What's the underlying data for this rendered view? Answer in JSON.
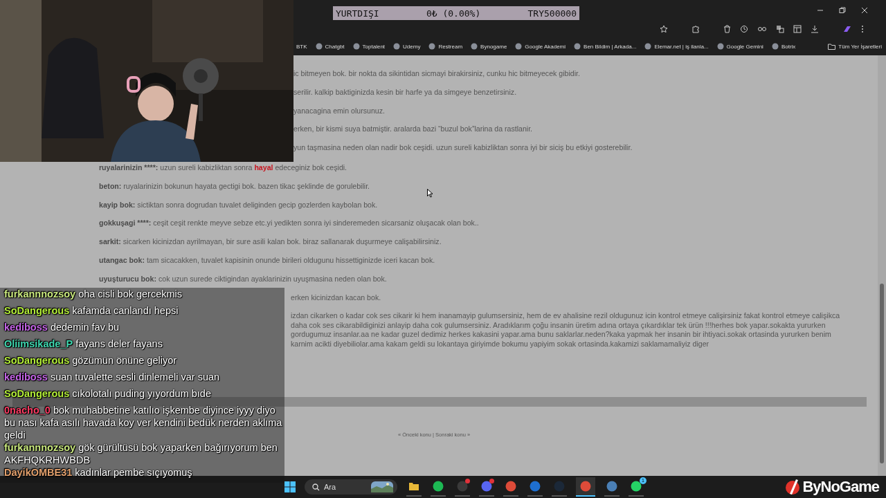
{
  "ticker": {
    "label": "YURTDIŞI",
    "change": "0₺ (0.00%)",
    "amount": "TRY500000"
  },
  "bookmarks": [
    {
      "label": "BTK",
      "kind": "plain"
    },
    {
      "label": "Chatgbt",
      "kind": "site"
    },
    {
      "label": "Toptalent",
      "kind": "site"
    },
    {
      "label": "Udemy",
      "kind": "site"
    },
    {
      "label": "Restream",
      "kind": "site"
    },
    {
      "label": "Bynogame",
      "kind": "site"
    },
    {
      "label": "Google Akademi",
      "kind": "site"
    },
    {
      "label": "Ben Bildim | Arkada...",
      "kind": "site"
    },
    {
      "label": "Elemar.net | iş ilanla...",
      "kind": "site"
    },
    {
      "label": "Google Gemini",
      "kind": "site"
    },
    {
      "label": "Botrix",
      "kind": "site"
    }
  ],
  "all_bookmarks": "Tüm Yer İşaretleri",
  "top_lines": [
    "ic bitmeyen bok. bir nokta da sikintidan sicmayi birakirsiniz, cunku hic bitmeyecek gibidir.",
    "serilir. kalkip baktiginizda kesin bir harfe ya da simgeye benzetirsiniz.",
    "yanacagina emin olursunuz.",
    "erken, bir kismi suya batmiştir. aralarda bazi “buzul bok”larina da rastlanir.",
    "yun taşmasina neden olan nadir bok ceşidi. uzun sureli kabizliktan sonra iyi bir siciş bu etkiyi gosterebilir."
  ],
  "entries": [
    {
      "term": "ruyalarinizin ****:",
      "segments": [
        {
          "text": "uzun sureli kabizliktan sonra",
          "kind": "plain"
        },
        {
          "text": "hayal",
          "kind": "red"
        },
        {
          "text": "edeceginiz bok ceşidi.",
          "kind": "plain"
        }
      ]
    },
    {
      "term": "beton:",
      "segments": [
        {
          "text": "ruyalarinizin bokunun hayata gectigi bok. bazen tikac şeklinde de gorulebilir.",
          "kind": "plain"
        }
      ]
    },
    {
      "term": "kayip bok:",
      "segments": [
        {
          "text": "sictiktan sonra dogrudan tuvalet deliginden gecip gozlerden kaybolan bok.",
          "kind": "plain"
        }
      ]
    },
    {
      "term": "gokkuşagi ****:",
      "segments": [
        {
          "text": "ceşit ceşit renkte meyve sebze etc.yi yedikten sonra iyi sinderemeden sicarsaniz oluşacak olan bok..",
          "kind": "plain"
        }
      ]
    },
    {
      "term": "sarkit:",
      "segments": [
        {
          "text": "sicarken kicinizdan ayrilmayan, bir sure asili kalan bok. biraz sallanarak duşurmeye calişabilirsiniz.",
          "kind": "plain"
        }
      ]
    },
    {
      "term": "utangac bok:",
      "segments": [
        {
          "text": "tam sicacakken, tuvalet kapisinin onunde birileri oldugunu hissettiginizde iceri kacan bok.",
          "kind": "plain"
        }
      ]
    },
    {
      "term": "uyuşturucu bok:",
      "segments": [
        {
          "text": "cok uzun surede ciktigindan ayaklarinizin uyuşmasina neden olan bok.",
          "kind": "plain"
        }
      ]
    }
  ],
  "partial_line": "erken kicinizdan kacan bok.",
  "partial_paragraph": "izdan cikarken o kadar cok ses cikarir ki hem inanamayip gulumsersiniz, hem de ev ahalisine rezil oldugunuz icin kontrol etmeye calişirsiniz fakat kontrol etmeye calişikca daha cok ses cikarabildiginizi anlayip daha cok gulumsersiniz. Aradıklarım çoğu insanin üretim adına ortaya çıkardıklar tek ürün !!!herhes bok yapar.sokakta yururken gordugumuz insanlar.aa ne kadar guzel dedimiz herkes kakasini yapar.ama bunu saklarlar.neden?kaka yapmak her insanin bir ihtiyaci.sokak ortasinda yururken benim karnim acikti diyebiliolar.ama kakam geldi su lokantaya giriyimde bokumu yapiyim sokak ortasinda.kakamizi saklamamaliyiz diger",
  "pagination": "« Önceki konu | Sonraki konu »",
  "chat": [
    {
      "user": "furkannnozsoy",
      "color": "#c9e87e",
      "message": "oha cisli bok gercekmis"
    },
    {
      "user": "SoDangerous",
      "color": "#b5ef3a",
      "message": "kafamda canlandı hepsi"
    },
    {
      "user": "kediboss",
      "color": "#c463e6",
      "message": "dedemin fav bu"
    },
    {
      "user": "Oliimsikade_P",
      "color": "#3fd8b0",
      "message": "fayans deler fayans"
    },
    {
      "user": "SoDangerous",
      "color": "#b5ef3a",
      "message": "gözümün önüne geliyor"
    },
    {
      "user": "kediboss",
      "color": "#c463e6",
      "message": "suan tuvalette sesli dinlemeli var suan"
    },
    {
      "user": "SoDangerous",
      "color": "#b5ef3a",
      "message": "cıkolotalı puding yıyordum bıde"
    },
    {
      "user": "0nacho_0",
      "color": "#ff3c64",
      "message": "bok muhabbetine katılıo işkembe diyince iyyy diyo bu nası kafa asılı havada koy ver kendini bedük nerden aklıma geldi"
    },
    {
      "user": "furkannnozsoy",
      "color": "#c9e87e",
      "message": "gök gürültüsü bok yaparken bağırıyorum ben AKFHQKRHWBDB"
    },
    {
      "user": "DayikOMBE31",
      "color": "#e3a06c",
      "message": "kadınlar pembe sıçıyomuş"
    }
  ],
  "taskbar": {
    "search": {
      "placeholder": "Ara"
    },
    "apps": [
      {
        "kind": "folder",
        "active": false,
        "alert": false
      },
      {
        "kind": "spotify",
        "active": false,
        "alert": false
      },
      {
        "kind": "obs",
        "active": false,
        "alert": true
      },
      {
        "kind": "discord",
        "active": false,
        "alert": true
      },
      {
        "kind": "chrome",
        "active": false,
        "alert": false
      },
      {
        "kind": "blue",
        "active": false,
        "alert": false
      },
      {
        "kind": "steam",
        "active": false,
        "alert": false
      },
      {
        "kind": "chrome",
        "active": true,
        "alert": false
      },
      {
        "kind": "gem",
        "active": false,
        "alert": false
      },
      {
        "kind": "whatsapp",
        "active": false,
        "alert": false,
        "badge": "1"
      }
    ]
  },
  "brand": "ByNoGame"
}
